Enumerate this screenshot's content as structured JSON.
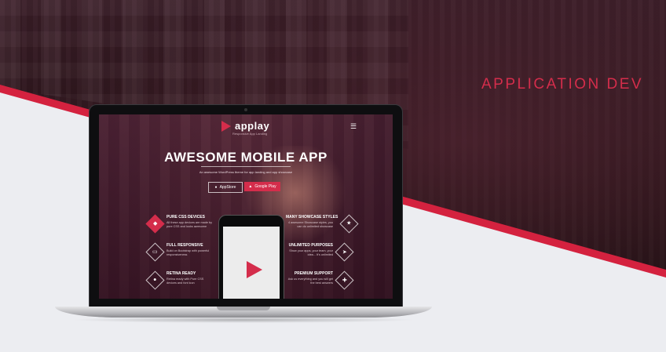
{
  "headline": "APPLICATION DEV",
  "screen": {
    "logo": "applay",
    "logo_sub": "Responsive App Landing",
    "menu_icon": "☰",
    "hero_title": "AWESOME MOBILE APP",
    "hero_sub": "An awesome WordPress theme for app landing and app showcase",
    "btn_appstore": "AppStore",
    "btn_googleplay": "Google Play",
    "features_left": [
      {
        "title": "PURE CSS DEVICES",
        "desc": "All these app devices are made by pure CSS and looks awesome",
        "icon": "◆"
      },
      {
        "title": "FULL RESPONSIVE",
        "desc": "Build on Bootstrap with powerful responsiveness",
        "icon": "▭"
      },
      {
        "title": "RETINA READY",
        "desc": "Retina ready with Pure CSS devices and font icon",
        "icon": "●"
      }
    ],
    "features_right": [
      {
        "title": "MANY SHOWCASE STYLES",
        "desc": "4 awesome Showcase styles, you can do unlimited showcase",
        "icon": "★"
      },
      {
        "title": "UNLIMITED PURPOSES",
        "desc": "Show your apps, your team, your idea... It's unlimited",
        "icon": "➤"
      },
      {
        "title": "PREMIUM SUPPORT",
        "desc": "Ask us everything and you will get the best answers",
        "icon": "✚"
      }
    ]
  },
  "colors": {
    "accent": "#d42d4b",
    "dark_bg": "#2a1419",
    "light_bg": "#ecedf1"
  }
}
